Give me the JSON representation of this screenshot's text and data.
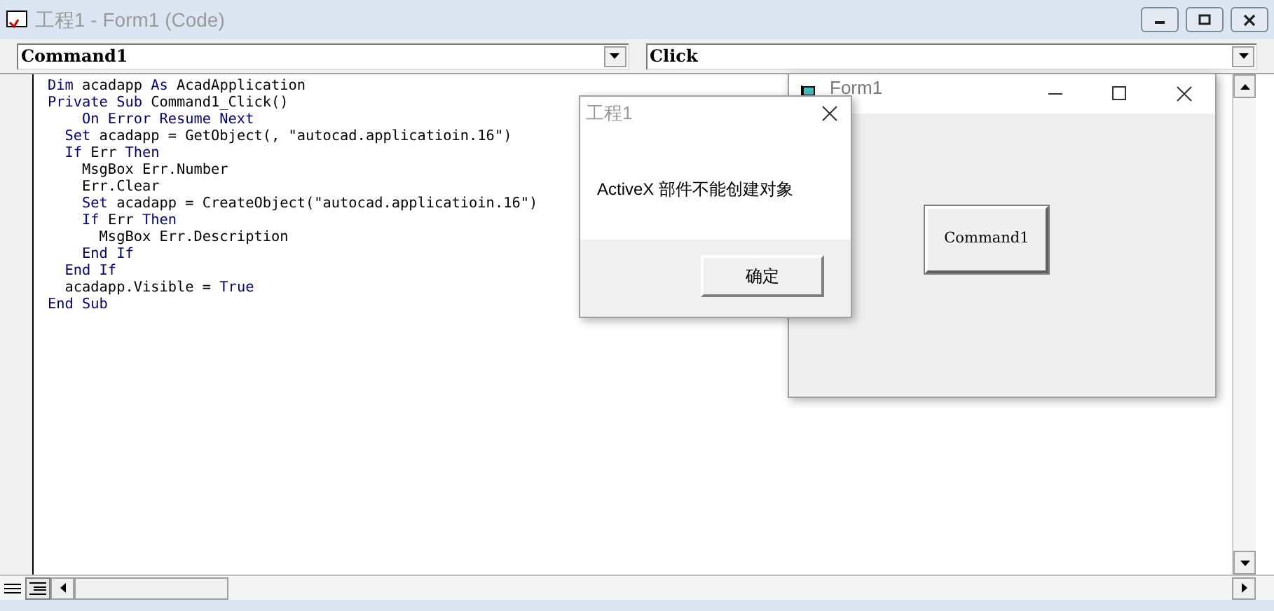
{
  "window": {
    "title": "工程1 - Form1 (Code)"
  },
  "object_combo": {
    "value": "Command1"
  },
  "procedure_combo": {
    "value": "Click"
  },
  "code_lines": [
    [
      {
        "text": "Dim",
        "kind": "keyword"
      },
      {
        "text": " acadapp ",
        "kind": "plain"
      },
      {
        "text": "As",
        "kind": "keyword"
      },
      {
        "text": " AcadApplication",
        "kind": "plain"
      }
    ],
    [
      {
        "text": "Private Sub",
        "kind": "keyword"
      },
      {
        "text": " Command1_Click()",
        "kind": "plain"
      }
    ],
    [
      {
        "text": "    On Error Resume Next",
        "kind": "keyword"
      }
    ],
    [
      {
        "text": "  Set",
        "kind": "keyword"
      },
      {
        "text": " acadapp = GetObject(, \"autocad.applicatioin.16\")",
        "kind": "plain"
      }
    ],
    [
      {
        "text": "  If",
        "kind": "keyword"
      },
      {
        "text": " Err ",
        "kind": "plain"
      },
      {
        "text": "Then",
        "kind": "keyword"
      }
    ],
    [
      {
        "text": "    MsgBox Err.Number",
        "kind": "plain"
      }
    ],
    [
      {
        "text": "    Err.Clear",
        "kind": "plain"
      }
    ],
    [
      {
        "text": "    Set",
        "kind": "keyword"
      },
      {
        "text": " acadapp = CreateObject(\"autocad.applicatioin.16\")",
        "kind": "plain"
      }
    ],
    [
      {
        "text": "    If",
        "kind": "keyword"
      },
      {
        "text": " Err ",
        "kind": "plain"
      },
      {
        "text": "Then",
        "kind": "keyword"
      }
    ],
    [
      {
        "text": "      MsgBox Err.Description",
        "kind": "plain"
      }
    ],
    [
      {
        "text": "    End If",
        "kind": "keyword"
      }
    ],
    [
      {
        "text": "  End If",
        "kind": "keyword"
      }
    ],
    [
      {
        "text": "  acadapp.Visible = ",
        "kind": "plain"
      },
      {
        "text": "True",
        "kind": "keyword"
      }
    ],
    [
      {
        "text": "End Sub",
        "kind": "keyword"
      }
    ]
  ],
  "form_window": {
    "title": "Form1",
    "button": "Command1"
  },
  "message_box": {
    "title": "工程1",
    "message": "ActiveX 部件不能创建对象",
    "ok_button": "确定"
  }
}
